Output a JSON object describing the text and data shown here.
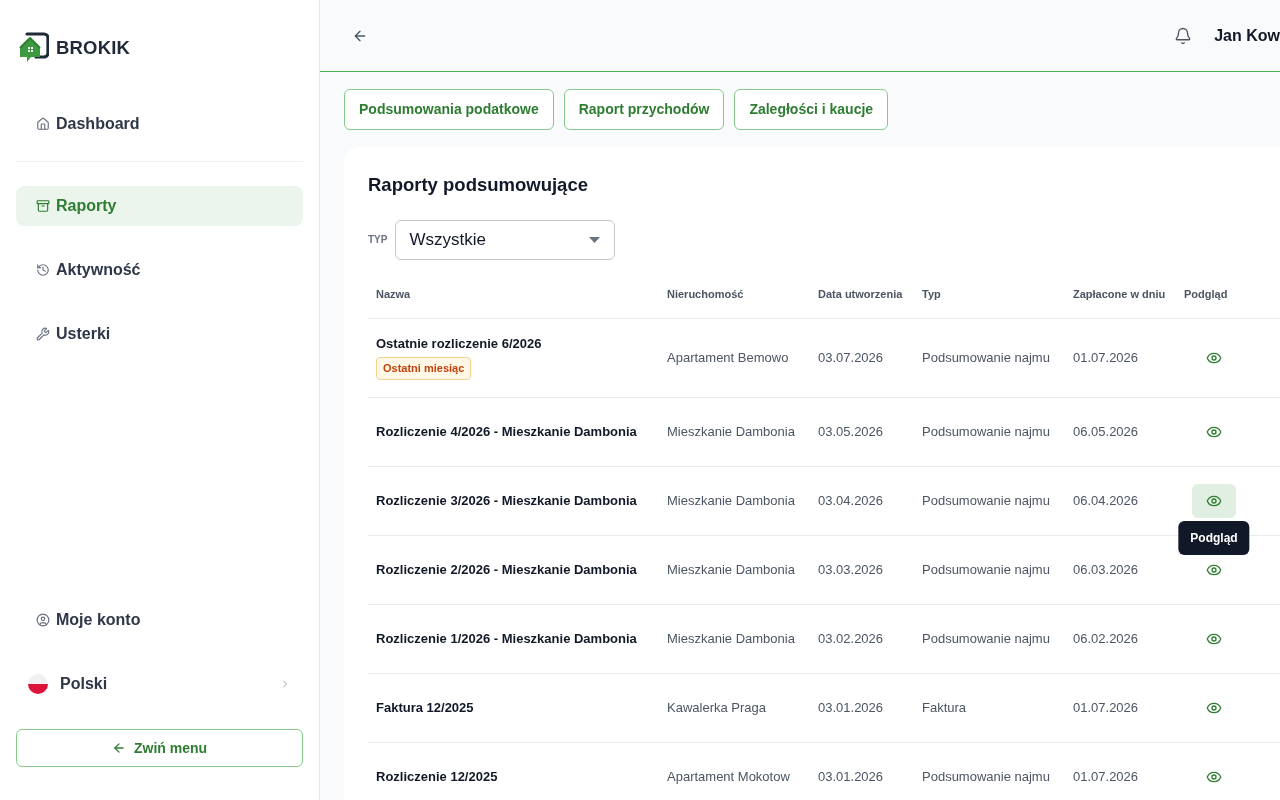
{
  "sidebar": {
    "logo": "BROKIK",
    "nav_groups": [
      {
        "items": [
          {
            "label": "Dashboard",
            "selected": false
          }
        ]
      },
      {
        "items": [
          {
            "label": "Raporty",
            "selected": true
          },
          {
            "label": "Aktywność",
            "selected": false
          },
          {
            "label": "Usterki",
            "selected": false
          }
        ]
      }
    ],
    "account": {
      "label": "Moje konto"
    },
    "language": {
      "label": "Polski"
    },
    "collapse_button": "Zwiń menu"
  },
  "header": {
    "user_name": "Jan Kow"
  },
  "report_tabs": [
    {
      "label": "Podsumowania podatkowe"
    },
    {
      "label": "Raport przychodów"
    },
    {
      "label": "Zaległości i kaucje"
    }
  ],
  "card": {
    "title": "Raporty podsumowujące",
    "filter": {
      "label": "TYP",
      "value": "Wszystkie"
    }
  },
  "table": {
    "columns": [
      "Nazwa",
      "Nieruchomość",
      "Data utworzenia",
      "Typ",
      "Zapłacone w dniu",
      "Podgląd"
    ],
    "rows": [
      {
        "name": "Ostatnie rozliczenie 6/2026",
        "badge": "Ostatni miesiąc",
        "property": "Apartament Bemowo",
        "created": "03.07.2026",
        "type": "Podsumowanie najmu",
        "paid": "01.07.2026",
        "hovered": false
      },
      {
        "name": "Rozliczenie 4/2026 - Mieszkanie Dambonia",
        "property": "Mieszkanie Dambonia",
        "created": "03.05.2026",
        "type": "Podsumowanie najmu",
        "paid": "06.05.2026",
        "hovered": false
      },
      {
        "name": "Rozliczenie 3/2026 - Mieszkanie Dambonia",
        "property": "Mieszkanie Dambonia",
        "created": "03.04.2026",
        "type": "Podsumowanie najmu",
        "paid": "06.04.2026",
        "hovered": true,
        "tooltip": "Podgląd"
      },
      {
        "name": "Rozliczenie 2/2026 - Mieszkanie Dambonia",
        "property": "Mieszkanie Dambonia",
        "created": "03.03.2026",
        "type": "Podsumowanie najmu",
        "paid": "06.03.2026",
        "hovered": false
      },
      {
        "name": "Rozliczenie 1/2026 - Mieszkanie Dambonia",
        "property": "Mieszkanie Dambonia",
        "created": "03.02.2026",
        "type": "Podsumowanie najmu",
        "paid": "06.02.2026",
        "hovered": false
      },
      {
        "name": "Faktura 12/2025",
        "property": "Kawalerka Praga",
        "created": "03.01.2026",
        "type": "Faktura",
        "paid": "01.07.2026",
        "hovered": false
      },
      {
        "name": "Rozliczenie 12/2025",
        "property": "Apartament Mokotow",
        "created": "03.01.2026",
        "type": "Podsumowanie najmu",
        "paid": "01.07.2026",
        "hovered": false
      }
    ]
  }
}
